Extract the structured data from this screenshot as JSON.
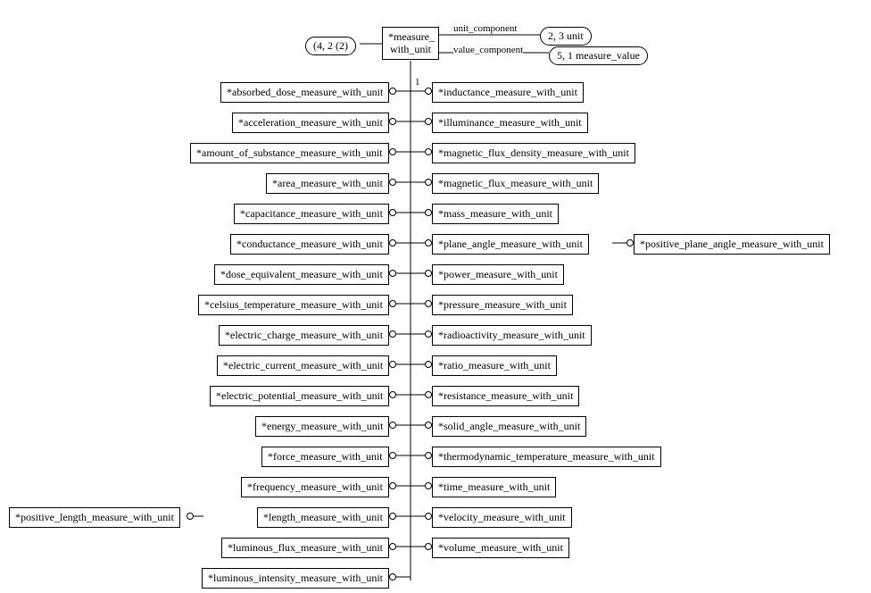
{
  "root": {
    "label": "*measure_\nwith_unit"
  },
  "constraint_pill": "(4, 2 (2)",
  "attrs": {
    "unit_label": "unit_component",
    "unit_pill": "2, 3 unit",
    "value_label": "value_component",
    "value_pill": "5, 1 measure_value"
  },
  "trunk_card": "1",
  "left": [
    "*absorbed_dose_measure_with_unit",
    "*acceleration_measure_with_unit",
    "*amount_of_substance_measure_with_unit",
    "*area_measure_with_unit",
    "*capacitance_measure_with_unit",
    "*conductance_measure_with_unit",
    "*dose_equivalent_measure_with_unit",
    "*celsius_temperature_measure_with_unit",
    "*electric_charge_measure_with_unit",
    "*electric_current_measure_with_unit",
    "*electric_potential_measure_with_unit",
    "*energy_measure_with_unit",
    "*force_measure_with_unit",
    "*frequency_measure_with_unit",
    "*length_measure_with_unit",
    "*luminous_flux_measure_with_unit",
    "*luminous_intensity_measure_with_unit"
  ],
  "right": [
    "*inductance_measure_with_unit",
    "*illuminance_measure_with_unit",
    "*magnetic_flux_density_measure_with_unit",
    "*magnetic_flux_measure_with_unit",
    "*mass_measure_with_unit",
    "*plane_angle_measure_with_unit",
    "*power_measure_with_unit",
    "*pressure_measure_with_unit",
    "*radioactivity_measure_with_unit",
    "*ratio_measure_with_unit",
    "*resistance_measure_with_unit",
    "*solid_angle_measure_with_unit",
    "*thermodynamic_temperature_measure_with_unit",
    "*time_measure_with_unit",
    "*velocity_measure_with_unit",
    "*volume_measure_with_unit"
  ],
  "far_left": "*positive_length_measure_with_unit",
  "far_right": "*positive_plane_angle_measure_with_unit"
}
